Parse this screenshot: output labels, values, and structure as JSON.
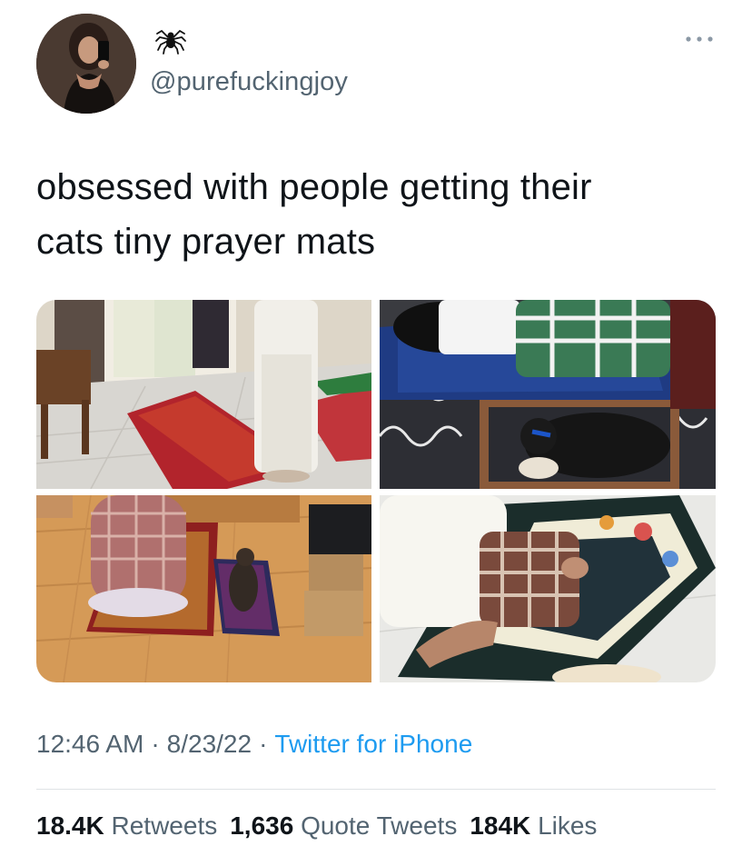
{
  "author": {
    "handle": "@purefuckingjoy",
    "avatar_icon": "user-avatar",
    "name_emoji_icon": "spider-icon"
  },
  "menu": {
    "more_icon": "more-horizontal-icon"
  },
  "tweet": {
    "text": "obsessed with people getting their\ncats tiny prayer mats"
  },
  "meta": {
    "time": "12:46 AM",
    "separator": "·",
    "date": "8/23/22",
    "source": "Twitter for iPhone"
  },
  "stats": {
    "retweets_count": "18.4K",
    "retweets_label": "Retweets",
    "quotes_count": "1,636",
    "quotes_label": "Quote Tweets",
    "likes_count": "184K",
    "likes_label": "Likes"
  },
  "colors": {
    "text": "#0f1419",
    "secondary": "#536471",
    "link": "#1d9bf0",
    "divider": "#dfe3e6"
  }
}
